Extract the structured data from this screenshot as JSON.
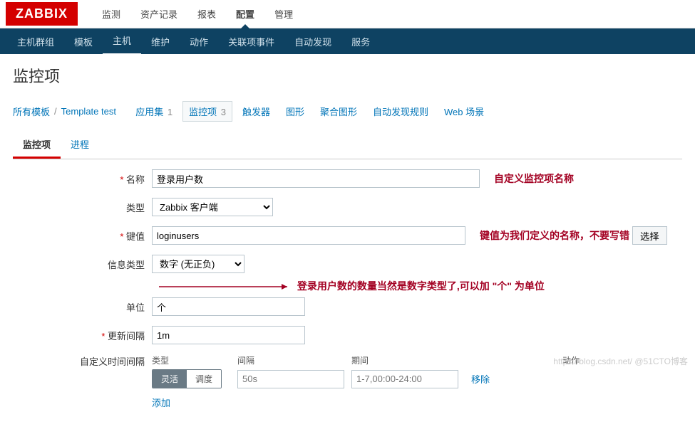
{
  "logo": "ZABBIX",
  "mainNav": {
    "items": [
      "监测",
      "资产记录",
      "报表",
      "配置",
      "管理"
    ],
    "activeIndex": 3
  },
  "subNav": {
    "items": [
      "主机群组",
      "模板",
      "主机",
      "维护",
      "动作",
      "关联项事件",
      "自动发现",
      "服务"
    ],
    "activeIndex": 2
  },
  "pageTitle": "监控项",
  "breadcrumb": {
    "root": "所有模板",
    "template": "Template test",
    "items": [
      {
        "label": "应用集",
        "count": "1"
      },
      {
        "label": "监控项",
        "count": "3",
        "active": true
      },
      {
        "label": "触发器"
      },
      {
        "label": "图形"
      },
      {
        "label": "聚合图形"
      },
      {
        "label": "自动发现规则"
      },
      {
        "label": "Web 场景"
      }
    ]
  },
  "innerTabs": {
    "items": [
      "监控项",
      "进程"
    ],
    "activeIndex": 0
  },
  "form": {
    "name": {
      "label": "名称",
      "value": "登录用户数"
    },
    "type": {
      "label": "类型",
      "value": "Zabbix 客户端"
    },
    "key": {
      "label": "键值",
      "value": "loginusers",
      "selectBtn": "选择"
    },
    "infoType": {
      "label": "信息类型",
      "value": "数字 (无正负)"
    },
    "unit": {
      "label": "单位",
      "value": "个"
    },
    "updateInterval": {
      "label": "更新间隔",
      "value": "1m"
    },
    "customInterval": {
      "label": "自定义时间间隔",
      "headers": {
        "type": "类型",
        "interval": "间隔",
        "period": "期间",
        "action": "动作"
      },
      "segActive": "灵活",
      "segOther": "调度",
      "intervalPh": "50s",
      "periodPh": "1-7,00:00-24:00",
      "remove": "移除",
      "add": "添加"
    }
  },
  "annotations": {
    "name": "自定义监控项名称",
    "key": "键值为我们定义的名称，不要写错",
    "unit": "登录用户数的数量当然是数字类型了,可以加 \"个\" 为单位"
  },
  "watermark": "https://blog.csdn.net/   @51CTO博客"
}
